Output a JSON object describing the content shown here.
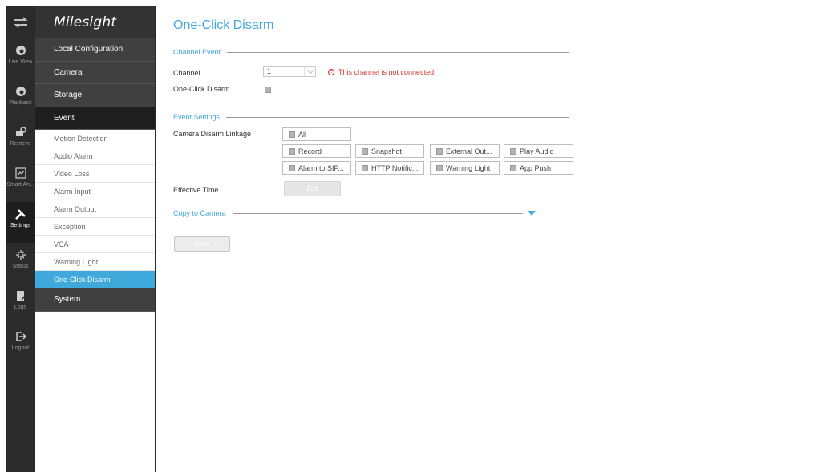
{
  "app": {
    "logo": "Milesight"
  },
  "rail": {
    "top_icon": "swap-arrows-icon",
    "items": [
      {
        "label": "Live View",
        "icon": "live-view-icon"
      },
      {
        "label": "Playback",
        "icon": "playback-icon"
      },
      {
        "label": "Retrieve",
        "icon": "retrieve-icon"
      },
      {
        "label": "Smart An...",
        "icon": "smart-analysis-icon"
      },
      {
        "label": "Settings",
        "icon": "settings-icon"
      },
      {
        "label": "Status",
        "icon": "status-icon"
      },
      {
        "label": "Logs",
        "icon": "logs-icon"
      },
      {
        "label": "Logout",
        "icon": "logout-icon"
      }
    ]
  },
  "menu": {
    "main": [
      {
        "label": "Local Configuration"
      },
      {
        "label": "Camera"
      },
      {
        "label": "Storage"
      },
      {
        "label": "Event"
      },
      {
        "label": "System"
      }
    ],
    "event_sub": [
      {
        "label": "Motion Detection"
      },
      {
        "label": "Audio Alarm"
      },
      {
        "label": "Video Loss"
      },
      {
        "label": "Alarm Input"
      },
      {
        "label": "Alarm Output"
      },
      {
        "label": "Exception"
      },
      {
        "label": "VCA"
      },
      {
        "label": "Warning Light"
      },
      {
        "label": "One-Click Disarm"
      }
    ]
  },
  "page": {
    "title": "One-Click Disarm",
    "channel_event": {
      "section_title": "Channel Event",
      "channel_label": "Channel",
      "channel_value": "1",
      "error": "This channel is not connected.",
      "disarm_label": "One-Click Disarm"
    },
    "event_settings": {
      "section_title": "Event Settings",
      "linkage_label": "Camera Disarm Linkage",
      "options": {
        "all": "All",
        "record": "Record",
        "snapshot": "Snapshot",
        "external_out": "External Out...",
        "play_audio": "Play Audio",
        "alarm_to_sip": "Alarm to SIP...",
        "http_notific": "HTTP Notific...",
        "warning_light": "Warning Light",
        "app_push": "App Push"
      },
      "effective_time_label": "Effective Time",
      "edit_button": "Edit"
    },
    "copy_to_camera": "Copy to Camera",
    "save_button": "Save"
  },
  "colors": {
    "accent": "#3fa9dc",
    "error": "#d8332b",
    "rail": "#2b2b2b"
  }
}
